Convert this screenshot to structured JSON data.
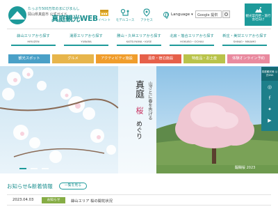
{
  "header": {
    "logo_tagline": "たっぷり500万年のまにびまんし",
    "logo_sub": "岡山県真庭市 公式ガイド",
    "logo_title": "真庭観光WEB",
    "nav": [
      {
        "label": "イベント",
        "icon": "calendar-icon"
      },
      {
        "label": "モデルコース",
        "icon": "route-icon"
      },
      {
        "label": "アクセス",
        "icon": "access-icon"
      }
    ],
    "language_label": "Language",
    "search_value": "Google 提供",
    "tour_button_label": "観光案内所・旅行会社向け"
  },
  "area_nav": [
    {
      "label": "蒜山エリアから探す",
      "en": "HIRUZEN"
    },
    {
      "label": "湯原エリアから探す",
      "en": "YUBARA"
    },
    {
      "label": "勝山・久世エリアから探す",
      "en": "KATSUYAMA・KUSE"
    },
    {
      "label": "北房・落合エリアから探す",
      "en": "HOKUBO・OCHIAI"
    },
    {
      "label": "新庄・美甘エリアから探す",
      "en": "SHINJO・MIKAMO"
    }
  ],
  "categories": [
    {
      "label": "観光スポット",
      "color": "#4aa0c7"
    },
    {
      "label": "グルメ",
      "color": "#e7b54b"
    },
    {
      "label": "アクティビティ施設",
      "color": "#f09d2c"
    },
    {
      "label": "温泉・宿泊施設",
      "color": "#e6604a"
    },
    {
      "label": "特産品・お土産",
      "color": "#b9c34a"
    },
    {
      "label": "体験オンライン予約",
      "color": "#e98a9f"
    }
  ],
  "hero": {
    "title": "真庭",
    "subtitle": "山ざとに春を告げる",
    "accent": "桜",
    "tail": "めぐり",
    "credit": "醍醐桜 2023"
  },
  "side_bar": {
    "top_label": "真庭観光局 公式SNS",
    "icons": [
      "instagram-icon",
      "facebook-icon",
      "twitter-icon",
      "youtube-icon"
    ]
  },
  "news": {
    "heading": "お知らせ&新着情報",
    "list_button": "一覧を見る",
    "items": [
      {
        "date": "2023.04.03",
        "tag": "お知らせ",
        "title": "蒜山エリア 桜の開花状況"
      }
    ]
  },
  "colors": {
    "brand": "#1d9a9a",
    "brand_dark": "#1d7f8a"
  }
}
